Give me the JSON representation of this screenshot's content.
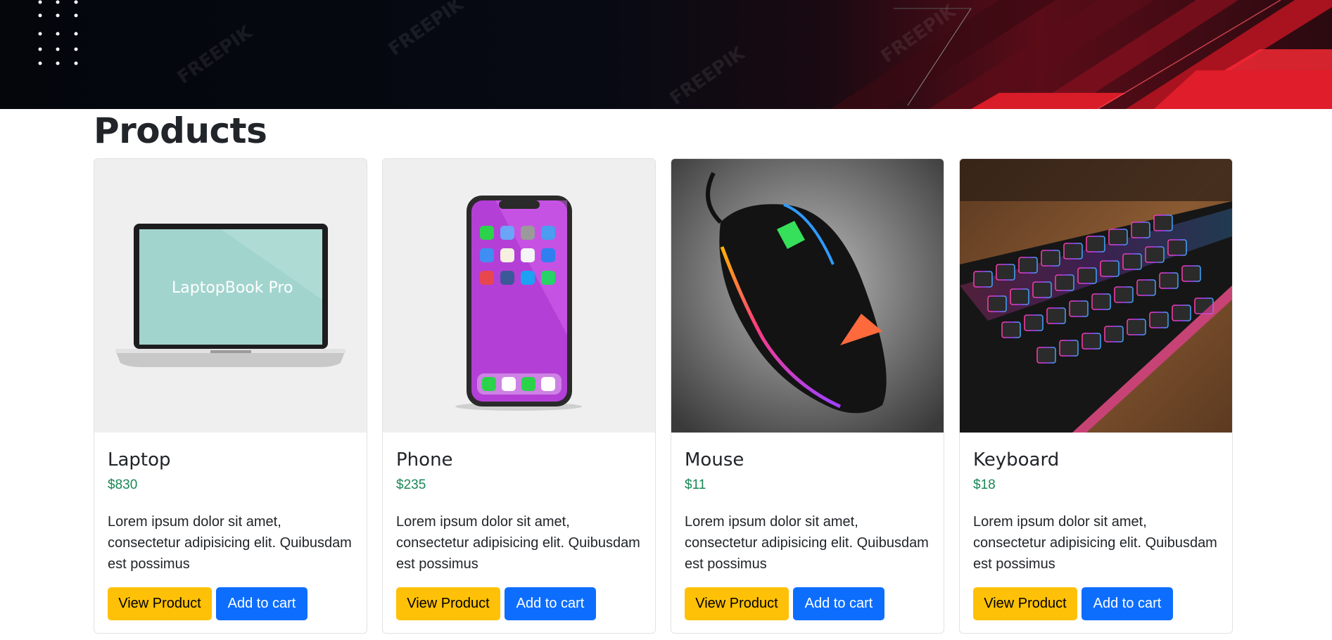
{
  "page": {
    "title": "Products"
  },
  "colors": {
    "price": "#198754",
    "view_button": "#ffc107",
    "cart_button": "#0d6efd",
    "banner_accent": "#e01d2a"
  },
  "banner": {
    "watermark": "FREEPIK"
  },
  "products": [
    {
      "name": "Laptop",
      "price": "$830",
      "description": "Lorem ipsum dolor sit amet, consectetur adipisicing elit. Quibusdam est possimus",
      "image_icon": "laptop-image",
      "screen_text": "LaptopBook Pro",
      "view_label": "View Product",
      "cart_label": "Add to cart"
    },
    {
      "name": "Phone",
      "price": "$235",
      "description": "Lorem ipsum dolor sit amet, consectetur adipisicing elit. Quibusdam est possimus",
      "image_icon": "phone-image",
      "view_label": "View Product",
      "cart_label": "Add to cart"
    },
    {
      "name": "Mouse",
      "price": "$11",
      "description": "Lorem ipsum dolor sit amet, consectetur adipisicing elit. Quibusdam est possimus",
      "image_icon": "mouse-image",
      "view_label": "View Product",
      "cart_label": "Add to cart"
    },
    {
      "name": "Keyboard",
      "price": "$18",
      "description": "Lorem ipsum dolor sit amet, consectetur adipisicing elit. Quibusdam est possimus",
      "image_icon": "keyboard-image",
      "view_label": "View Product",
      "cart_label": "Add to cart"
    }
  ]
}
